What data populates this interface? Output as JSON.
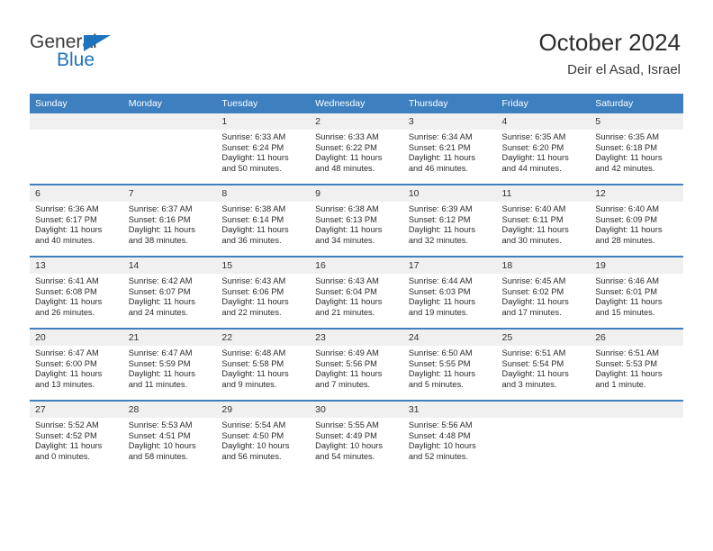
{
  "brand": {
    "name_line1": "General",
    "name_line2": "Blue",
    "logo_icon": "blue-triangle-flag-icon",
    "accent_color": "#1e73be"
  },
  "header": {
    "title": "October 2024",
    "subtitle": "Deir el Asad, Israel"
  },
  "theme": {
    "header_bar_color": "#3d7fbf",
    "daynum_band_color": "#f0f0f0",
    "row_divider_color": "#3d7fbf"
  },
  "calendar": {
    "weekday_headers": [
      "Sunday",
      "Monday",
      "Tuesday",
      "Wednesday",
      "Thursday",
      "Friday",
      "Saturday"
    ],
    "weeks": [
      [
        {
          "day": "",
          "sunrise": "",
          "sunset": "",
          "daylight": "",
          "blank": true
        },
        {
          "day": "",
          "sunrise": "",
          "sunset": "",
          "daylight": "",
          "blank": true
        },
        {
          "day": "1",
          "sunrise": "Sunrise: 6:33 AM",
          "sunset": "Sunset: 6:24 PM",
          "daylight": "Daylight: 11 hours and 50 minutes."
        },
        {
          "day": "2",
          "sunrise": "Sunrise: 6:33 AM",
          "sunset": "Sunset: 6:22 PM",
          "daylight": "Daylight: 11 hours and 48 minutes."
        },
        {
          "day": "3",
          "sunrise": "Sunrise: 6:34 AM",
          "sunset": "Sunset: 6:21 PM",
          "daylight": "Daylight: 11 hours and 46 minutes."
        },
        {
          "day": "4",
          "sunrise": "Sunrise: 6:35 AM",
          "sunset": "Sunset: 6:20 PM",
          "daylight": "Daylight: 11 hours and 44 minutes."
        },
        {
          "day": "5",
          "sunrise": "Sunrise: 6:35 AM",
          "sunset": "Sunset: 6:18 PM",
          "daylight": "Daylight: 11 hours and 42 minutes."
        }
      ],
      [
        {
          "day": "6",
          "sunrise": "Sunrise: 6:36 AM",
          "sunset": "Sunset: 6:17 PM",
          "daylight": "Daylight: 11 hours and 40 minutes."
        },
        {
          "day": "7",
          "sunrise": "Sunrise: 6:37 AM",
          "sunset": "Sunset: 6:16 PM",
          "daylight": "Daylight: 11 hours and 38 minutes."
        },
        {
          "day": "8",
          "sunrise": "Sunrise: 6:38 AM",
          "sunset": "Sunset: 6:14 PM",
          "daylight": "Daylight: 11 hours and 36 minutes."
        },
        {
          "day": "9",
          "sunrise": "Sunrise: 6:38 AM",
          "sunset": "Sunset: 6:13 PM",
          "daylight": "Daylight: 11 hours and 34 minutes."
        },
        {
          "day": "10",
          "sunrise": "Sunrise: 6:39 AM",
          "sunset": "Sunset: 6:12 PM",
          "daylight": "Daylight: 11 hours and 32 minutes."
        },
        {
          "day": "11",
          "sunrise": "Sunrise: 6:40 AM",
          "sunset": "Sunset: 6:11 PM",
          "daylight": "Daylight: 11 hours and 30 minutes."
        },
        {
          "day": "12",
          "sunrise": "Sunrise: 6:40 AM",
          "sunset": "Sunset: 6:09 PM",
          "daylight": "Daylight: 11 hours and 28 minutes."
        }
      ],
      [
        {
          "day": "13",
          "sunrise": "Sunrise: 6:41 AM",
          "sunset": "Sunset: 6:08 PM",
          "daylight": "Daylight: 11 hours and 26 minutes."
        },
        {
          "day": "14",
          "sunrise": "Sunrise: 6:42 AM",
          "sunset": "Sunset: 6:07 PM",
          "daylight": "Daylight: 11 hours and 24 minutes."
        },
        {
          "day": "15",
          "sunrise": "Sunrise: 6:43 AM",
          "sunset": "Sunset: 6:06 PM",
          "daylight": "Daylight: 11 hours and 22 minutes."
        },
        {
          "day": "16",
          "sunrise": "Sunrise: 6:43 AM",
          "sunset": "Sunset: 6:04 PM",
          "daylight": "Daylight: 11 hours and 21 minutes."
        },
        {
          "day": "17",
          "sunrise": "Sunrise: 6:44 AM",
          "sunset": "Sunset: 6:03 PM",
          "daylight": "Daylight: 11 hours and 19 minutes."
        },
        {
          "day": "18",
          "sunrise": "Sunrise: 6:45 AM",
          "sunset": "Sunset: 6:02 PM",
          "daylight": "Daylight: 11 hours and 17 minutes."
        },
        {
          "day": "19",
          "sunrise": "Sunrise: 6:46 AM",
          "sunset": "Sunset: 6:01 PM",
          "daylight": "Daylight: 11 hours and 15 minutes."
        }
      ],
      [
        {
          "day": "20",
          "sunrise": "Sunrise: 6:47 AM",
          "sunset": "Sunset: 6:00 PM",
          "daylight": "Daylight: 11 hours and 13 minutes."
        },
        {
          "day": "21",
          "sunrise": "Sunrise: 6:47 AM",
          "sunset": "Sunset: 5:59 PM",
          "daylight": "Daylight: 11 hours and 11 minutes."
        },
        {
          "day": "22",
          "sunrise": "Sunrise: 6:48 AM",
          "sunset": "Sunset: 5:58 PM",
          "daylight": "Daylight: 11 hours and 9 minutes."
        },
        {
          "day": "23",
          "sunrise": "Sunrise: 6:49 AM",
          "sunset": "Sunset: 5:56 PM",
          "daylight": "Daylight: 11 hours and 7 minutes."
        },
        {
          "day": "24",
          "sunrise": "Sunrise: 6:50 AM",
          "sunset": "Sunset: 5:55 PM",
          "daylight": "Daylight: 11 hours and 5 minutes."
        },
        {
          "day": "25",
          "sunrise": "Sunrise: 6:51 AM",
          "sunset": "Sunset: 5:54 PM",
          "daylight": "Daylight: 11 hours and 3 minutes."
        },
        {
          "day": "26",
          "sunrise": "Sunrise: 6:51 AM",
          "sunset": "Sunset: 5:53 PM",
          "daylight": "Daylight: 11 hours and 1 minute."
        }
      ],
      [
        {
          "day": "27",
          "sunrise": "Sunrise: 5:52 AM",
          "sunset": "Sunset: 4:52 PM",
          "daylight": "Daylight: 11 hours and 0 minutes."
        },
        {
          "day": "28",
          "sunrise": "Sunrise: 5:53 AM",
          "sunset": "Sunset: 4:51 PM",
          "daylight": "Daylight: 10 hours and 58 minutes."
        },
        {
          "day": "29",
          "sunrise": "Sunrise: 5:54 AM",
          "sunset": "Sunset: 4:50 PM",
          "daylight": "Daylight: 10 hours and 56 minutes."
        },
        {
          "day": "30",
          "sunrise": "Sunrise: 5:55 AM",
          "sunset": "Sunset: 4:49 PM",
          "daylight": "Daylight: 10 hours and 54 minutes."
        },
        {
          "day": "31",
          "sunrise": "Sunrise: 5:56 AM",
          "sunset": "Sunset: 4:48 PM",
          "daylight": "Daylight: 10 hours and 52 minutes."
        },
        {
          "day": "",
          "sunrise": "",
          "sunset": "",
          "daylight": "",
          "blank": true
        },
        {
          "day": "",
          "sunrise": "",
          "sunset": "",
          "daylight": "",
          "blank": true
        }
      ]
    ]
  }
}
